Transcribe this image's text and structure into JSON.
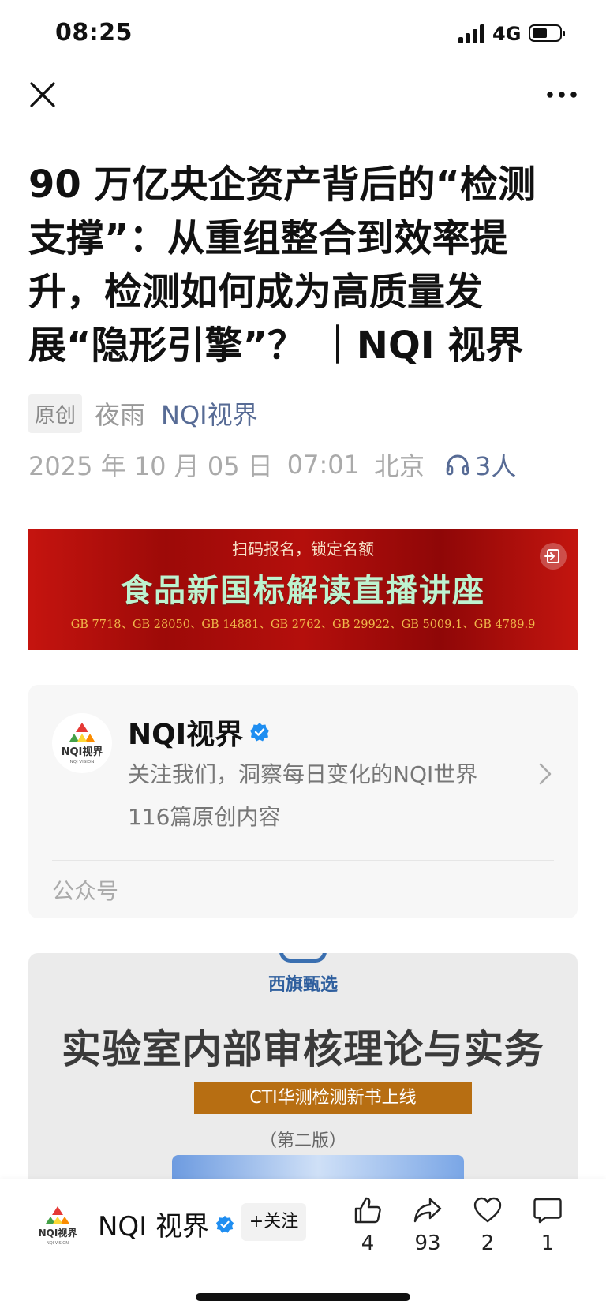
{
  "status_bar": {
    "time": "08:25",
    "network": "4G",
    "signal_bars": 4,
    "battery_level_percent": 45
  },
  "nav": {
    "close_icon": "close-icon",
    "more_icon": "more-icon"
  },
  "article": {
    "title": "90 万亿央企资产背后的“检测支撑”：从重组整合到效率提升，检测如何成为高质量发展“隐形引擎”？ ｜NQI 视界",
    "original_tag": "原创",
    "author": "夜雨",
    "account": "NQI视界",
    "date": "2025 年 10 月 05 日",
    "time": "07:01",
    "location": "北京",
    "listeners": "3人"
  },
  "banner": {
    "top_text": "扫码报名，锁定名额",
    "main_text": "食品新国标解读直播讲座",
    "bottom_text": "GB 7718、GB 28050、GB 14881、GB 2762、GB 29922、GB 5009.1、GB 4789.9"
  },
  "account_card": {
    "name": "NQI视界",
    "logo_text": "NQI视界",
    "logo_subtext": "NQI VISION",
    "description": "关注我们，洞察每日变化的NQI世界",
    "count": "116篇原创内容",
    "type": "公众号"
  },
  "ad_image": {
    "brand": "西旗甄选",
    "title": "实验室内部审核理论与实务",
    "strip": "CTI华测检测新书上线",
    "edition": "（第二版）"
  },
  "bottom_bar": {
    "account": "NQI 视界",
    "logo_text": "NQI视界",
    "follow": "+关注",
    "likes": "4",
    "shares": "93",
    "favorites": "2",
    "comments": "1"
  },
  "colors": {
    "link": "#576b95",
    "verified": "#1f8ef1",
    "banner_red": "#b40f0c",
    "banner_green": "#bdf3d0",
    "strip_orange": "#b76e12"
  }
}
